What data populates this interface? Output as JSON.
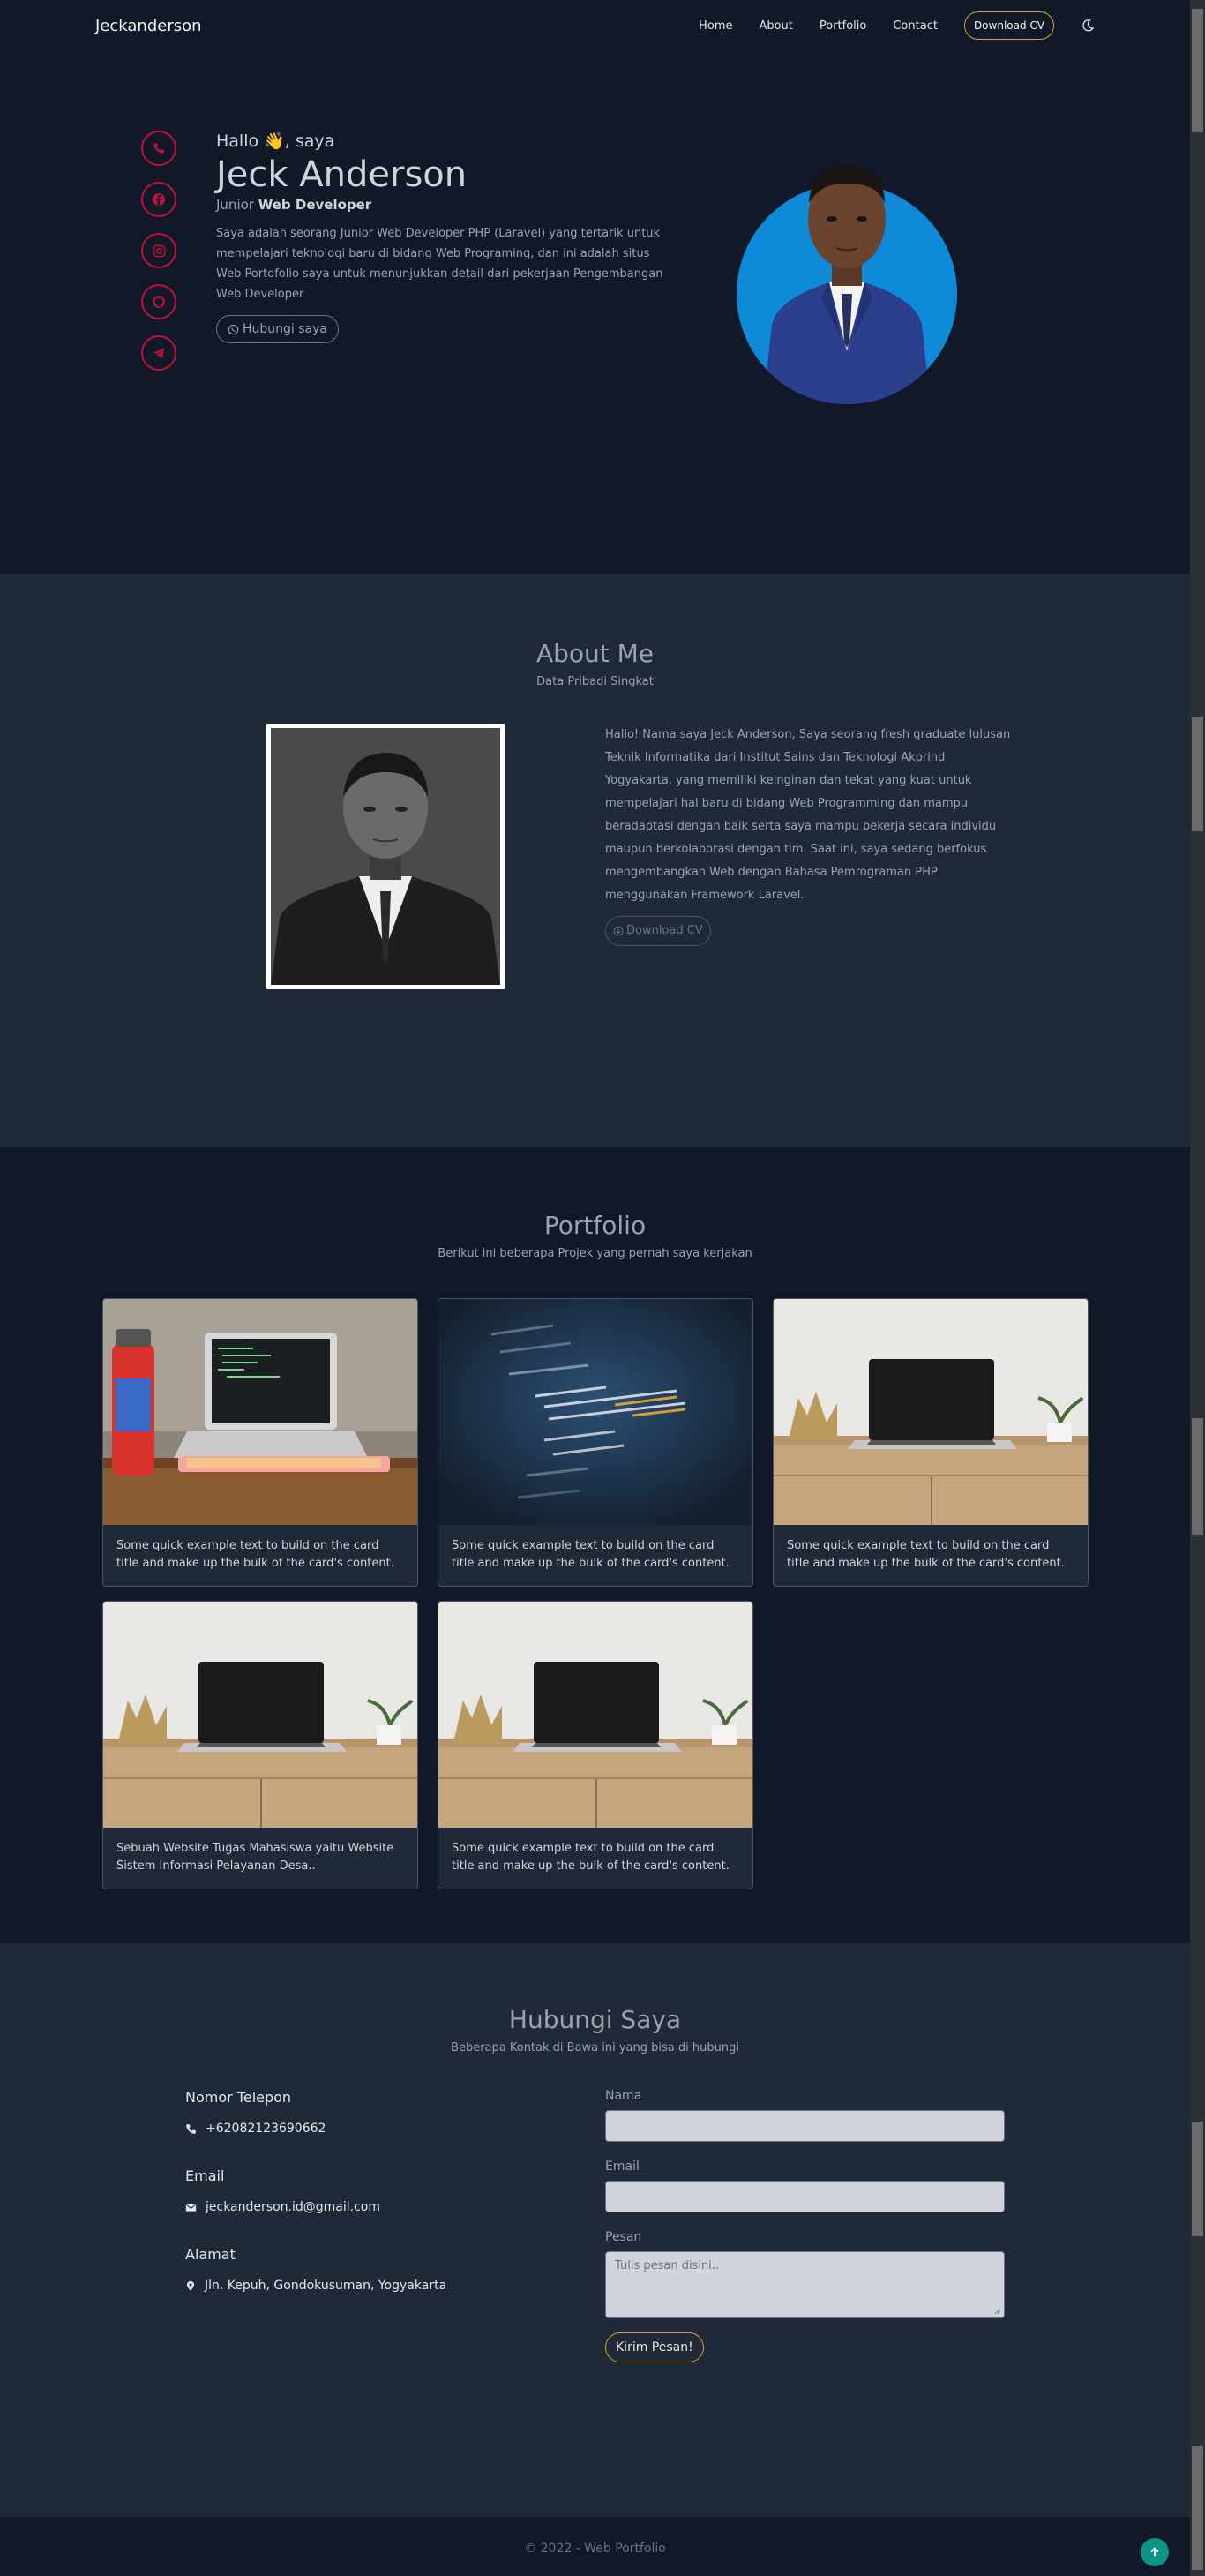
{
  "nav": {
    "brand": "Jeckanderson",
    "links": [
      "Home",
      "About",
      "Portfolio",
      "Contact"
    ],
    "cv_button": "Download CV"
  },
  "hero": {
    "hello": "Hallo 👋, saya",
    "name": "Jeck Anderson",
    "role_prefix": "Junior",
    "role_main": "Web Developer",
    "intro": "Saya adalah seorang Junior Web Developer PHP (Laravel) yang tertarik untuk mempelajari teknologi baru di bidang Web Programing, dan ini adalah situs Web Portofolio saya untuk menunjukkan detail dari pekerjaan Pengembangan Web Developer",
    "contact_button": "Hubungi saya",
    "social_icons": [
      "phone-icon",
      "facebook-icon",
      "instagram-icon",
      "github-icon",
      "telegram-icon"
    ]
  },
  "about": {
    "title": "About Me",
    "subtitle": "Data Pribadi Singkat",
    "text": "Hallo! Nama saya Jeck Anderson, Saya seorang fresh graduate lulusan Teknik Informatika dari Institut Sains dan Teknologi Akprind Yogyakarta, yang memiliki keinginan dan tekat yang kuat untuk mempelajari hal baru di bidang Web Programming dan mampu beradaptasi dengan baik serta saya mampu bekerja secara individu maupun berkolaborasi dengan tim. Saat ini, saya sedang berfokus mengembangkan Web dengan Bahasa Pemrograman PHP menggunakan Framework Laravel.",
    "download_button": "Download CV"
  },
  "portfolio": {
    "title": "Portfolio",
    "subtitle": "Berikut ini beberapa Projek yang pernah saya kerjakan",
    "cards": [
      {
        "text": "Some quick example text to build on the card title and make up the bulk of the card's content."
      },
      {
        "text": "Some quick example text to build on the card title and make up the bulk of the card's content."
      },
      {
        "text": "Some quick example text to build on the card title and make up the bulk of the card's content."
      },
      {
        "text": "Sebuah Website Tugas Mahasiswa yaitu Website Sistem Informasi Pelayanan Desa.."
      },
      {
        "text": "Some quick example text to build on the card title and make up the bulk of the card's content."
      }
    ]
  },
  "contact": {
    "title": "Hubungi Saya",
    "subtitle": "Beberapa Kontak di Bawa ini yang bisa di hubungi",
    "phone_title": "Nomor Telepon",
    "phone": "+62082123690662",
    "email_title": "Email",
    "email": "jeckanderson.id@gmail.com",
    "address_title": "Alamat",
    "address": "Jln. Kepuh, Gondokusuman, Yogyakarta",
    "form": {
      "name_label": "Nama",
      "email_label": "Email",
      "message_label": "Pesan",
      "message_placeholder": "Tulis pesan disini..",
      "submit": "Kirim Pesan!"
    }
  },
  "footer": {
    "text": "© 2022 - Web Portfolio"
  },
  "colors": {
    "dark_bg": "#111827",
    "section_bg": "#1f2937",
    "accent_red": "#be123c",
    "accent_gold": "#d4a72c",
    "teal": "#0d9488"
  }
}
